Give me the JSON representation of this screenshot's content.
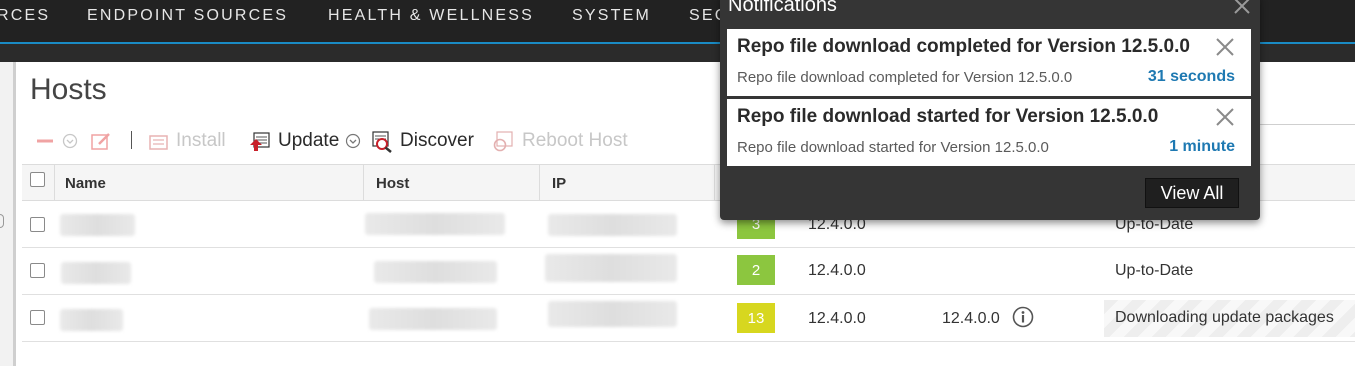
{
  "nav": {
    "items": [
      "RCES",
      "ENDPOINT SOURCES",
      "HEALTH & WELLNESS",
      "SYSTEM",
      "SEC"
    ]
  },
  "page": {
    "title": "Hosts"
  },
  "toolbar": {
    "install_label": "Install",
    "update_label": "Update",
    "discover_label": "Discover",
    "reboot_label": "Reboot Host"
  },
  "table": {
    "columns": [
      "Name",
      "Host",
      "IP"
    ],
    "rows": [
      {
        "badge": "3",
        "badge_color": "#8cc63f",
        "current_version": "12.4.0.0",
        "update_version": "",
        "status": "Up-to-Date"
      },
      {
        "badge": "2",
        "badge_color": "#8cc63f",
        "current_version": "12.4.0.0",
        "update_version": "",
        "status": "Up-to-Date"
      },
      {
        "badge": "13",
        "badge_color": "#d7d71f",
        "current_version": "12.4.0.0",
        "update_version": "12.4.0.0",
        "status": "Downloading update packages"
      }
    ]
  },
  "notifications": {
    "title": "Notifications",
    "items": [
      {
        "title": "Repo file download completed for Version 12.5.0.0",
        "message": "Repo file download completed for Version 12.5.0.0",
        "time": "31 seconds"
      },
      {
        "title": "Repo file download started for Version 12.5.0.0",
        "message": "Repo file download started for Version 12.5.0.0",
        "time": "1 minute"
      }
    ],
    "view_all_label": "View All"
  },
  "colors": {
    "accent": "#1a8bc4",
    "link": "#1e79b2",
    "badge_green": "#8cc63f",
    "badge_yellow": "#d7d71f",
    "update_icon_red": "#c8202a"
  }
}
